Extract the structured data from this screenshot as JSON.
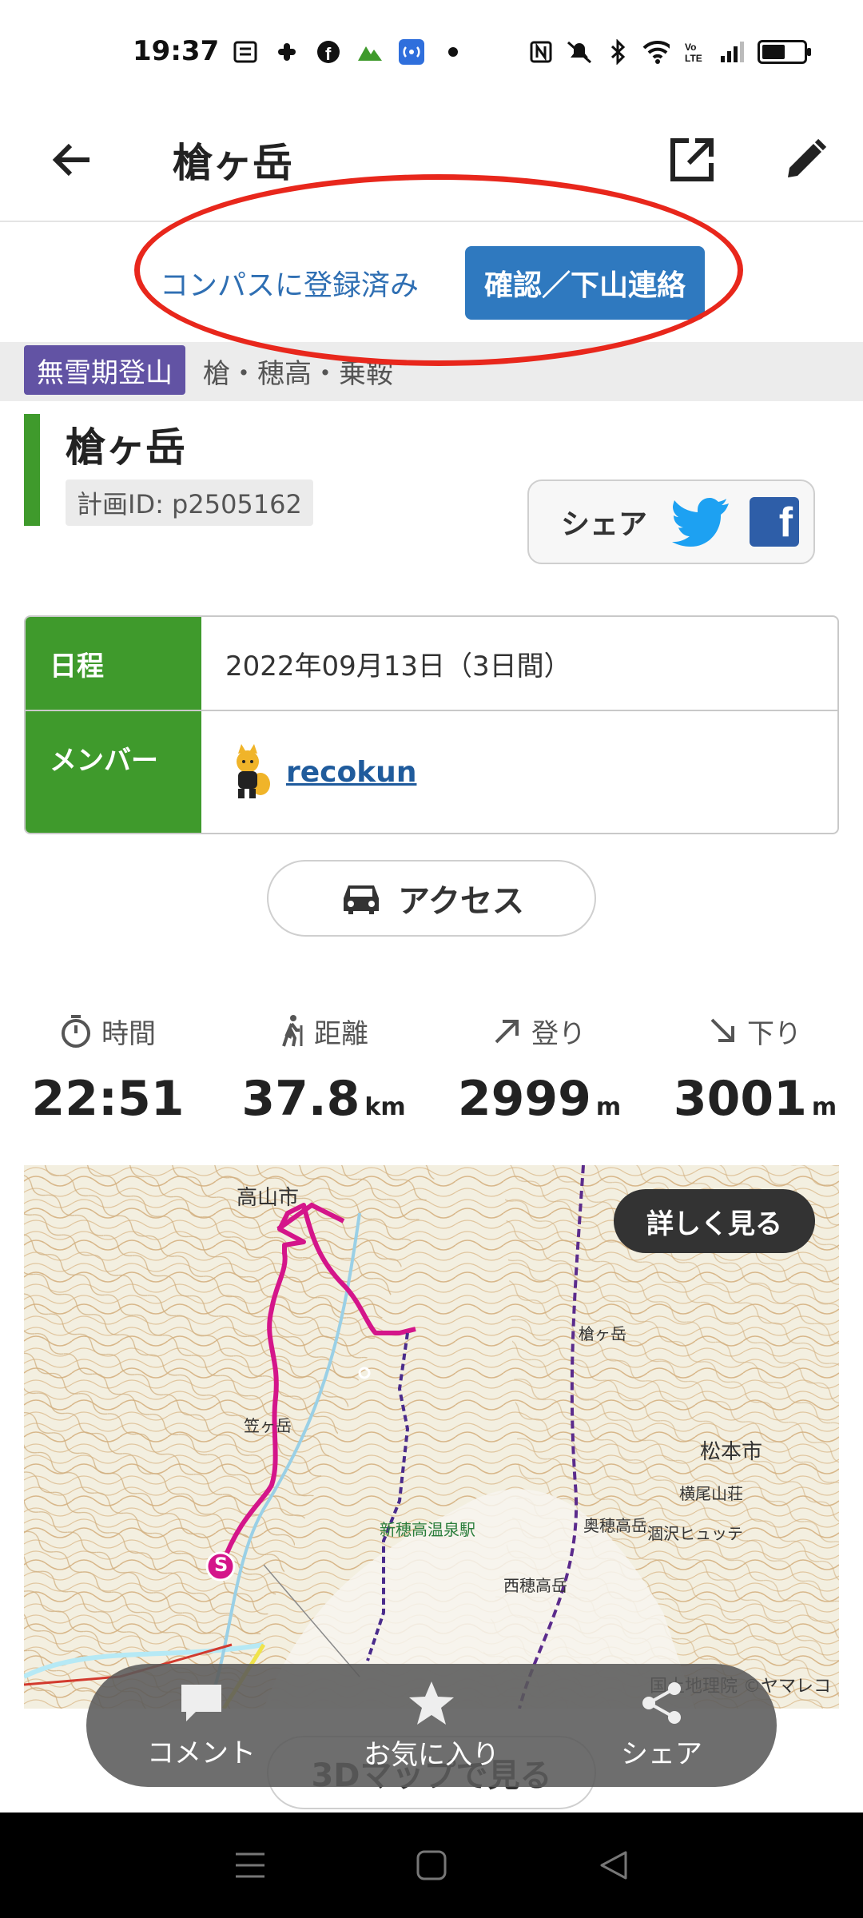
{
  "status_bar": {
    "time": "19:37"
  },
  "app_bar": {
    "title": "槍ヶ岳"
  },
  "compass": {
    "registered_text": "コンパスに登録済み",
    "confirm_button": "確認／下山連絡"
  },
  "category": {
    "badge": "無雪期登山",
    "area": "槍・穂高・乗鞍"
  },
  "plan": {
    "title": "槍ヶ岳",
    "plan_id": "計画ID: p2505162"
  },
  "share": {
    "label": "シェア"
  },
  "info_table": {
    "schedule_label": "日程",
    "schedule_value": "2022年09月13日（3日間）",
    "member_label": "メンバー",
    "member_name": "recokun"
  },
  "access_button": "アクセス",
  "stats": [
    {
      "label": "時間",
      "value": "22:51",
      "unit": "",
      "icon": "timer-icon"
    },
    {
      "label": "距離",
      "value": "37.8",
      "unit": "km",
      "icon": "hiker-icon"
    },
    {
      "label": "登り",
      "value": "2999",
      "unit": "m",
      "icon": "arrow-up-right-icon"
    },
    {
      "label": "下り",
      "value": "3001",
      "unit": "m",
      "icon": "arrow-down-right-icon"
    }
  ],
  "map": {
    "detail_button": "詳しく見る",
    "copyright": "国土地理院 ©ヤマレコ",
    "labels": {
      "takayama": "高山市",
      "yarigatake": "槍ヶ岳",
      "matsumoto": "松本市",
      "shinhotaka": "新穂高温泉駅",
      "kasagatake": "笠ヶ岳",
      "nishihotaka": "西穂高岳",
      "okuhotaka": "奥穂高岳",
      "karasawa": "涸沢ヒュッテ",
      "yokoo": "横尾山荘",
      "start_marker": "S"
    }
  },
  "map3d_button": "3Dマップで見る",
  "actions": {
    "comment": "コメント",
    "favorite": "お気に入り",
    "share": "シェア"
  },
  "colors": {
    "brand_green": "#3f9a2c",
    "badge_purple": "#6253a4",
    "confirm_blue": "#2f79bf",
    "route_magenta": "#d4158a",
    "highlight_red": "#e8271c"
  }
}
